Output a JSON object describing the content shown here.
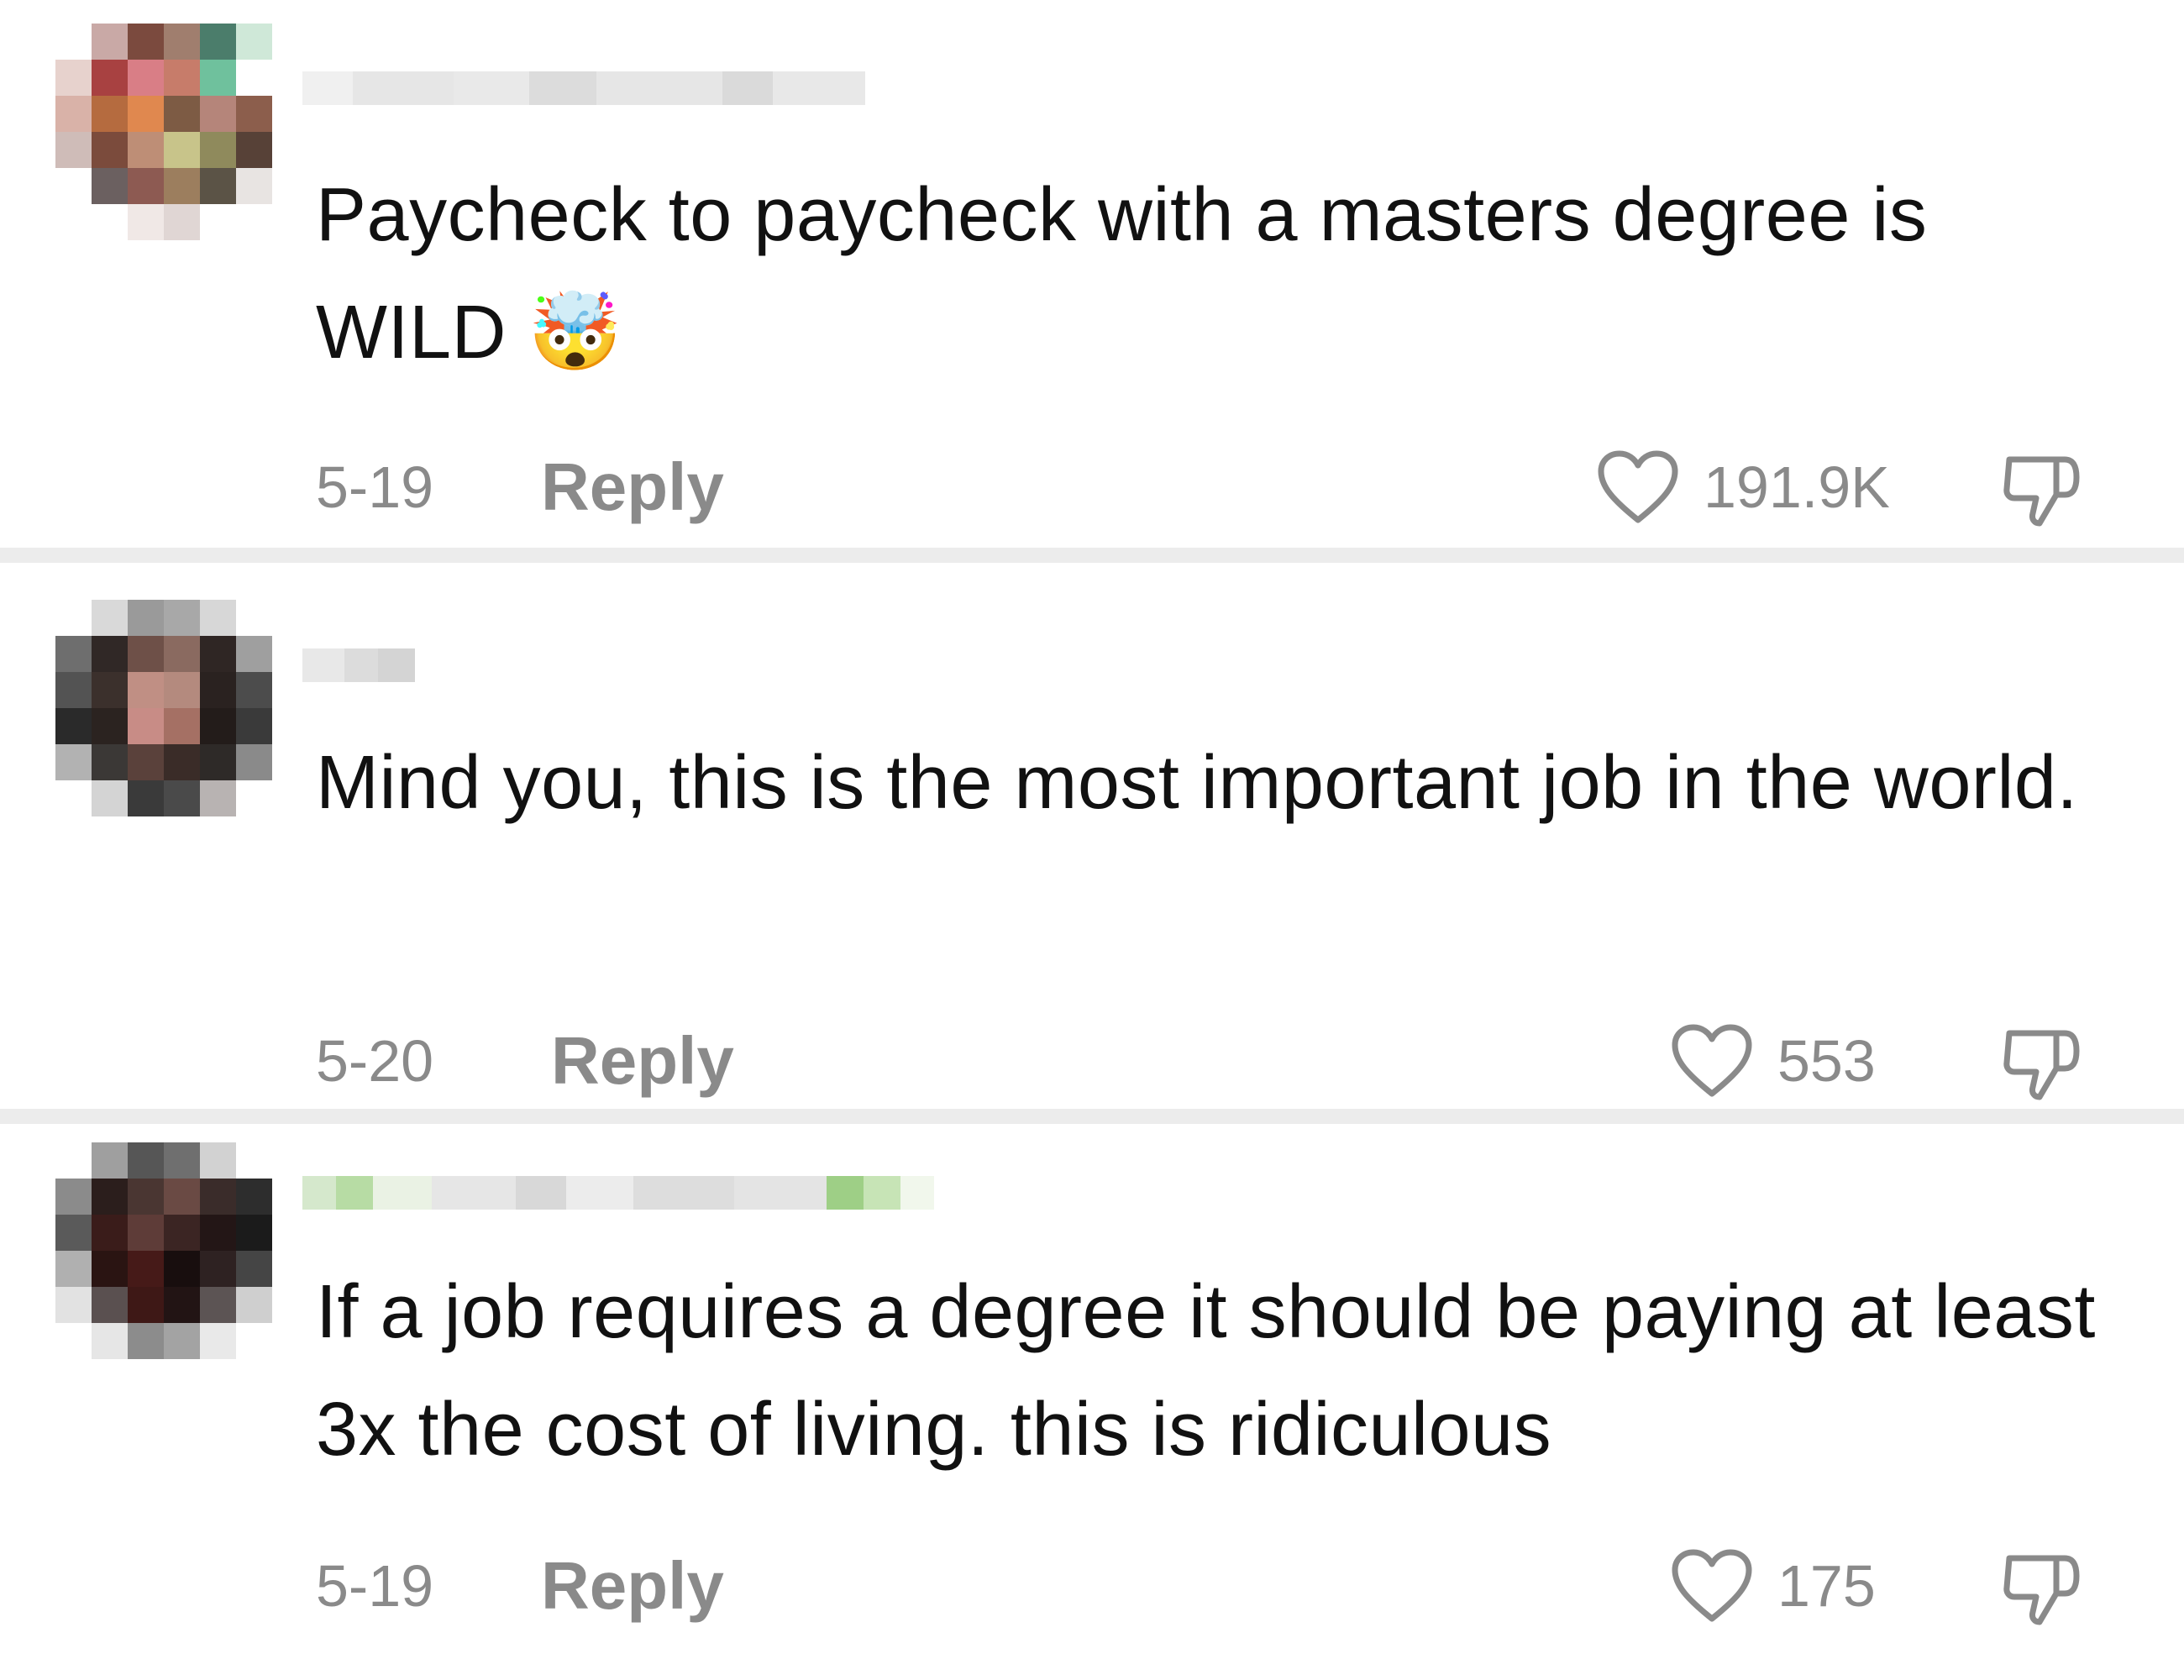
{
  "comments": [
    {
      "text": "Paycheck to paycheck with a masters degree is WILD",
      "emoji": "🤯",
      "date": "5-19",
      "reply_label": "Reply",
      "likes": "191.9K"
    },
    {
      "text": "Mind you, this is the most important job in the world.",
      "date": "5-20",
      "reply_label": "Reply",
      "likes": "553"
    },
    {
      "text": "If a job requires a degree it should be paying at least 3x the cost of living. this is ridiculous",
      "date": "5-19",
      "reply_label": "Reply",
      "likes": "175"
    }
  ],
  "icons": {
    "like": "heart-outline-icon",
    "dislike": "thumbs-down-icon"
  },
  "colors": {
    "text": "#111111",
    "meta": "#8a8a8a",
    "divider": "#ececec"
  }
}
